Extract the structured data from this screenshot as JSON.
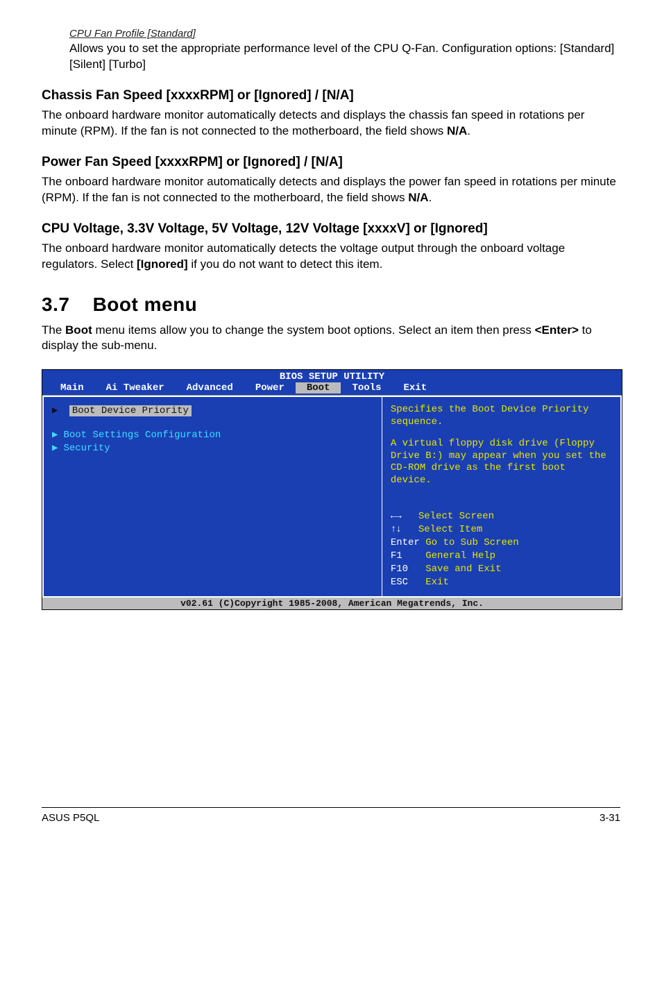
{
  "section1": {
    "subhead": "CPU Fan Profile [Standard]",
    "body": "Allows you to set the appropriate performance level of the CPU Q-Fan. Configuration options: [Standard] [Silent] [Turbo]"
  },
  "section2": {
    "title": "Chassis Fan Speed [xxxxRPM] or [Ignored] / [N/A]",
    "body_pre": "The onboard hardware monitor automatically detects and displays the chassis fan speed in rotations per minute (RPM). If the fan is not connected to the motherboard, the field shows ",
    "body_bold": "N/A",
    "body_post": "."
  },
  "section3": {
    "title": "Power Fan Speed [xxxxRPM] or [Ignored] / [N/A]",
    "body_pre": "The onboard hardware monitor automatically detects and displays the power fan speed in rotations per minute (RPM). If the fan is not connected to the motherboard, the field shows ",
    "body_bold": "N/A",
    "body_post": "."
  },
  "section4": {
    "title": "CPU Voltage, 3.3V Voltage, 5V Voltage, 12V Voltage [xxxxV] or [Ignored]",
    "body_pre": "The onboard hardware monitor automatically detects the voltage output through the onboard voltage regulators. Select ",
    "body_bold": "[Ignored]",
    "body_post": " if you do not want to detect this item."
  },
  "chapter": {
    "number": "3.7",
    "title": "Boot menu",
    "intro_pre": "The ",
    "intro_b1": "Boot",
    "intro_mid": " menu items allow you to change the system boot options. Select an item then press ",
    "intro_b2": "<Enter>",
    "intro_post": " to display the sub-menu."
  },
  "bios": {
    "title": "BIOS SETUP UTILITY",
    "tabs": [
      "Main",
      "Ai Tweaker",
      "Advanced",
      "Power",
      "Boot",
      "Tools",
      "Exit"
    ],
    "active_tab": "Boot",
    "items": [
      {
        "label": "Boot Device Priority",
        "selected": true
      },
      {
        "label": "Boot Settings Configuration",
        "selected": false
      },
      {
        "label": "Security",
        "selected": false
      }
    ],
    "help1": "Specifies the Boot Device Priority sequence.",
    "help2": "A virtual floppy disk drive (Floppy Drive B:) may appear when you set the CD-ROM drive as the first boot device.",
    "keys": {
      "k1": "Select Screen",
      "k2": "Select Item",
      "k3a": "Enter",
      "k3b": "Go to Sub Screen",
      "k4a": "F1",
      "k4b": "General Help",
      "k5a": "F10",
      "k5b": "Save and Exit",
      "k6a": "ESC",
      "k6b": "Exit"
    },
    "footer": "v02.61 (C)Copyright 1985-2008, American Megatrends, Inc."
  },
  "footer": {
    "left": "ASUS P5QL",
    "right": "3-31"
  }
}
